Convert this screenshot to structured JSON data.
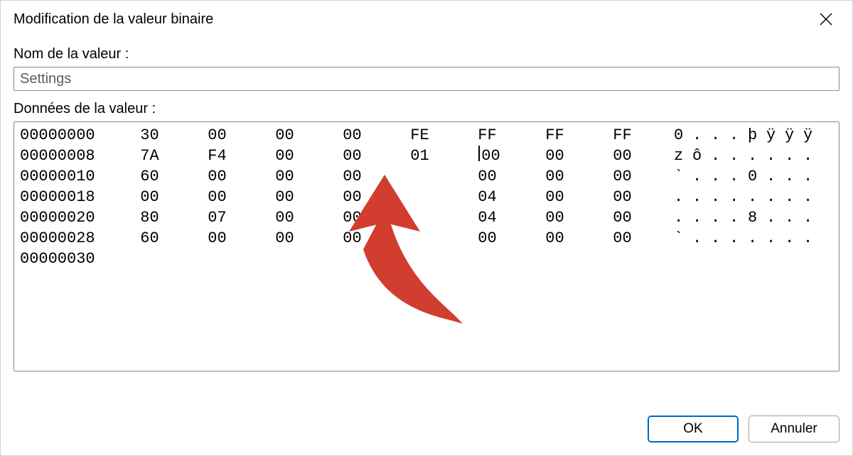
{
  "dialog": {
    "title": "Modification de la valeur binaire",
    "name_label": "Nom de la valeur :",
    "name_value": "Settings",
    "data_label": "Données de la valeur :",
    "ok_label": "OK",
    "cancel_label": "Annuler"
  },
  "hex": {
    "rows": [
      {
        "offset": "00000000",
        "bytes": [
          "30",
          "00",
          "00",
          "00",
          "FE",
          "FF",
          "FF",
          "FF"
        ],
        "ascii": [
          "0",
          ".",
          ".",
          ".",
          "þ",
          "ÿ",
          "ÿ",
          "ÿ"
        ]
      },
      {
        "offset": "00000008",
        "bytes": [
          "7A",
          "F4",
          "00",
          "00",
          "01",
          "00",
          "00",
          "00"
        ],
        "ascii": [
          "z",
          "ô",
          ".",
          ".",
          ".",
          ".",
          ".",
          "."
        ],
        "caret_after_byte": 5
      },
      {
        "offset": "00000010",
        "bytes": [
          "60",
          "00",
          "00",
          "00",
          "",
          "00",
          "00",
          "00"
        ],
        "ascii": [
          "`",
          ".",
          ".",
          ".",
          "0",
          ".",
          ".",
          "."
        ]
      },
      {
        "offset": "00000018",
        "bytes": [
          "00",
          "00",
          "00",
          "00",
          "",
          "04",
          "00",
          "00"
        ],
        "ascii": [
          ".",
          ".",
          ".",
          ".",
          ".",
          ".",
          ".",
          "."
        ]
      },
      {
        "offset": "00000020",
        "bytes": [
          "80",
          "07",
          "00",
          "00",
          "",
          "04",
          "00",
          "00"
        ],
        "ascii": [
          ".",
          ".",
          ".",
          ".",
          "8",
          ".",
          ".",
          "."
        ]
      },
      {
        "offset": "00000028",
        "bytes": [
          "60",
          "00",
          "00",
          "00",
          "",
          "00",
          "00",
          "00"
        ],
        "ascii": [
          "`",
          ".",
          ".",
          ".",
          ".",
          ".",
          ".",
          "."
        ]
      },
      {
        "offset": "00000030",
        "bytes": [
          "",
          "",
          "",
          "",
          "",
          "",
          "",
          ""
        ],
        "ascii": [
          "",
          "",
          "",
          "",
          "",
          "",
          "",
          ""
        ]
      }
    ]
  },
  "annotation": {
    "arrow_color": "#d13d2e"
  }
}
